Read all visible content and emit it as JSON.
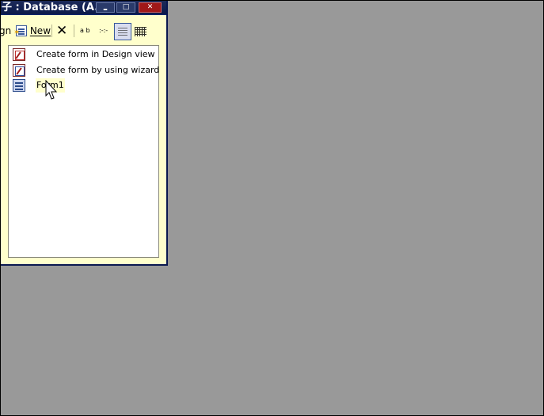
{
  "window": {
    "title": "子 : Database (A..."
  },
  "toolbar": {
    "design_label": "gn",
    "new_label": "New",
    "delete_glyph": "✕",
    "large_icons_glyph": "a  b",
    "small_icons_glyph": ":-:-"
  },
  "list": {
    "items": [
      {
        "label": "Create form in Design view",
        "icon": "design-view-icon"
      },
      {
        "label": "Create form by using wizard",
        "icon": "wizard-icon"
      },
      {
        "label": "Form1",
        "icon": "form-icon"
      }
    ]
  },
  "colors": {
    "desktop": "#999999",
    "titlebar": "#0c1a4a",
    "client": "#ffffcc",
    "listpane": "#ffffff"
  }
}
